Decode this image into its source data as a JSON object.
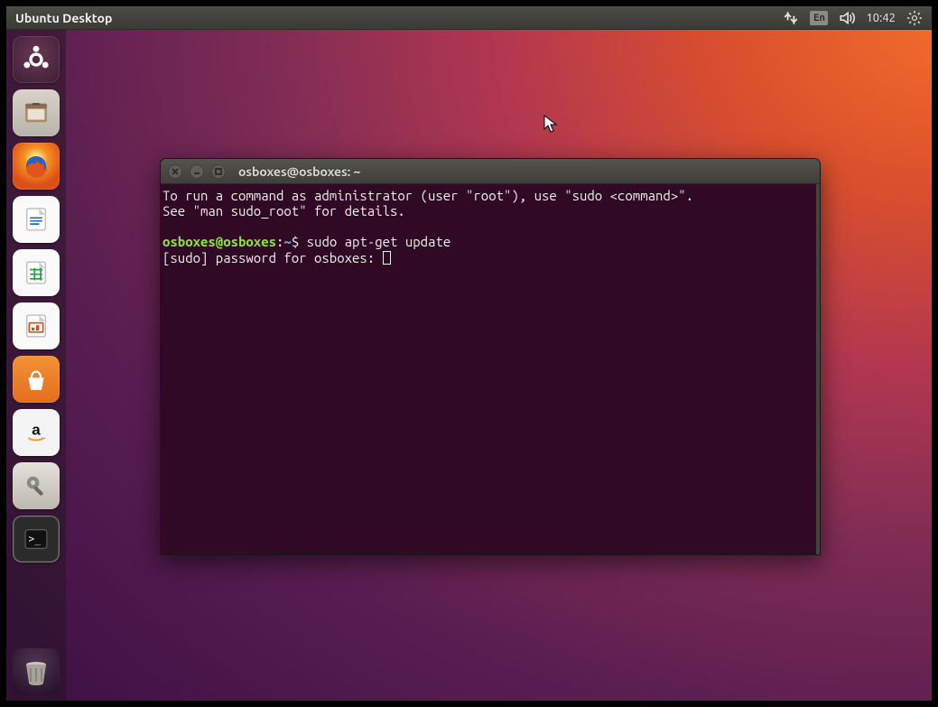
{
  "menubar": {
    "title": "Ubuntu Desktop",
    "lang_indicator": "En",
    "clock": "10:42"
  },
  "launcher": {
    "items": [
      {
        "name": "dash",
        "label": "Dash"
      },
      {
        "name": "files",
        "label": "Files"
      },
      {
        "name": "firefox",
        "label": "Firefox"
      },
      {
        "name": "writer",
        "label": "LibreOffice Writer"
      },
      {
        "name": "calc",
        "label": "LibreOffice Calc"
      },
      {
        "name": "impress",
        "label": "LibreOffice Impress"
      },
      {
        "name": "usc",
        "label": "Ubuntu Software"
      },
      {
        "name": "amazon",
        "label": "Amazon"
      },
      {
        "name": "settings",
        "label": "System Settings"
      },
      {
        "name": "terminal",
        "label": "Terminal"
      }
    ],
    "trash_label": "Trash"
  },
  "terminal": {
    "title": "osboxes@osboxes: ~",
    "motd_line1": "To run a command as administrator (user \"root\"), use \"sudo <command>\".",
    "motd_line2": "See \"man sudo_root\" for details.",
    "prompt_userhost": "osboxes@osboxes",
    "prompt_sep": ":",
    "prompt_path": "~",
    "prompt_symbol": "$ ",
    "command": "sudo apt-get update",
    "sudo_line": "[sudo] password for osboxes: "
  }
}
